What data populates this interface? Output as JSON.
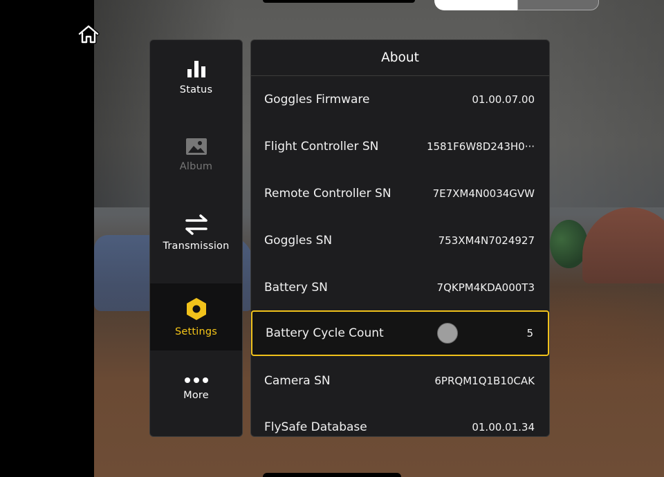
{
  "sidebar": {
    "items": [
      {
        "label": "Status",
        "icon": "bar-chart-icon",
        "state": "normal"
      },
      {
        "label": "Album",
        "icon": "image-icon",
        "state": "disabled"
      },
      {
        "label": "Transmission",
        "icon": "transfer-arrows-icon",
        "state": "normal"
      },
      {
        "label": "Settings",
        "icon": "hexagon-gear-icon",
        "state": "active"
      },
      {
        "label": "More",
        "icon": "more-dots-icon",
        "state": "normal"
      }
    ]
  },
  "panel": {
    "title": "About",
    "rows": [
      {
        "label": "Goggles Firmware",
        "value": "01.00.07.00"
      },
      {
        "label": "Flight Controller SN",
        "value": "1581F6W8D243H0···"
      },
      {
        "label": "Remote Controller SN",
        "value": "7E7XM4N0034GVW"
      },
      {
        "label": "Goggles SN",
        "value": "753XM4N7024927"
      },
      {
        "label": "Battery SN",
        "value": "7QKPM4KDA000T3"
      },
      {
        "label": "Battery Cycle Count",
        "value": "5"
      },
      {
        "label": "Camera SN",
        "value": "6PRQM1Q1B10CAK"
      },
      {
        "label": "FlySafe Database",
        "value": "01.00.01.34"
      }
    ]
  },
  "colors": {
    "accent": "#f1c21b",
    "panel_bg": "#1d1d1f",
    "disabled_text": "#777777"
  },
  "icons": {
    "home": "home-icon"
  }
}
